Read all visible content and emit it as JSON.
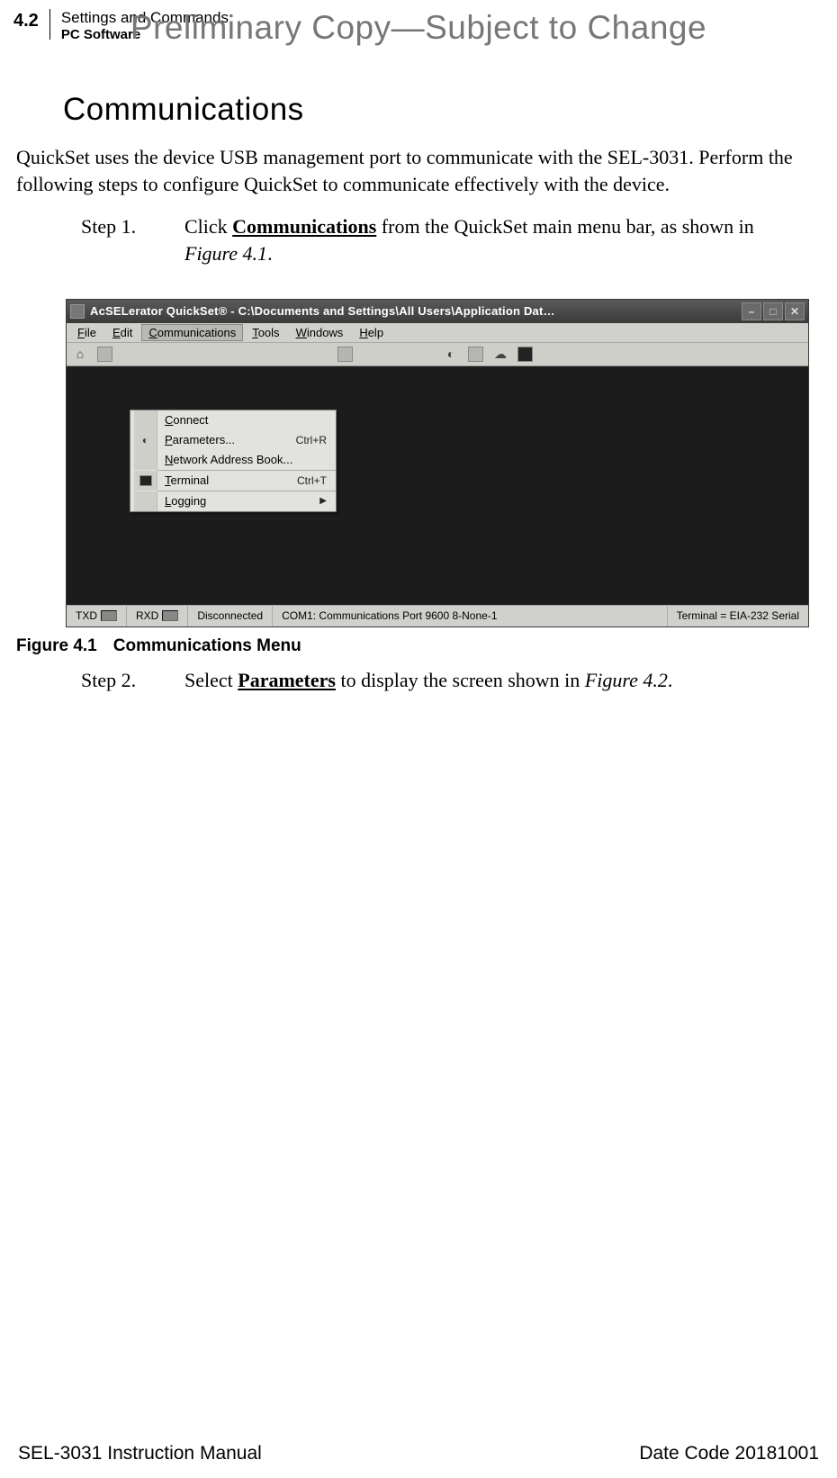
{
  "header": {
    "page_num": "4.2",
    "chapter": "Settings and Commands",
    "section": "PC Software"
  },
  "watermark": "Preliminary Copy—Subject to Change",
  "sub_heading": "Communications",
  "paragraph1": "QuickSet uses the device USB management port to communicate with the SEL-3031. Perform the following steps to configure QuickSet to communicate effectively with the device.",
  "step1": {
    "label": "Step 1.",
    "pre": "Click ",
    "bold": "Communications",
    "post": " from the QuickSet main menu bar, as shown in ",
    "figref": "Figure 4.1",
    "tail": "."
  },
  "screenshot": {
    "title": "AcSELerator QuickSet® - C:\\Documents and Settings\\All Users\\Application Dat…",
    "menubar": {
      "file": "File",
      "edit": "Edit",
      "comm": "Communications",
      "tools": "Tools",
      "windows": "Windows",
      "help": "Help"
    },
    "dropdown": {
      "connect": "Connect",
      "parameters": "Parameters...",
      "parameters_sc": "Ctrl+R",
      "nab": "Network Address Book...",
      "terminal": "Terminal",
      "terminal_sc": "Ctrl+T",
      "logging": "Logging"
    },
    "status": {
      "txd": "TXD",
      "rxd": "RXD",
      "conn": "Disconnected",
      "port": "COM1: Communications Port   9600  8-None-1",
      "term": "Terminal = EIA-232 Serial"
    }
  },
  "figure_caption": {
    "num": "Figure 4.1",
    "title": "Communications Menu"
  },
  "step2": {
    "label": "Step 2.",
    "pre": "Select ",
    "bold": "Parameters",
    "post": " to display the screen shown in ",
    "figref": "Figure 4.2",
    "tail": "."
  },
  "footer": {
    "left": "SEL-3031 Instruction Manual",
    "right": "Date Code 20181001"
  }
}
